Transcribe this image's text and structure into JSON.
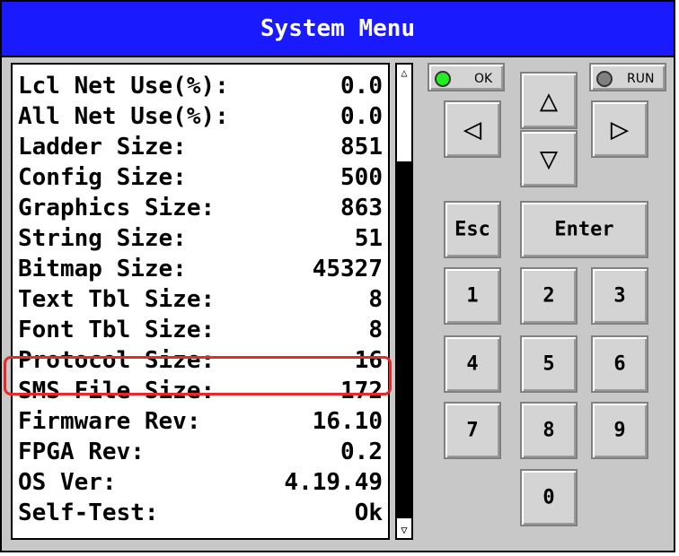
{
  "title": "System Menu",
  "rows": [
    {
      "label": "Lcl Net Use(%):",
      "value": "0.0"
    },
    {
      "label": "All Net Use(%):",
      "value": "0.0"
    },
    {
      "label": "Ladder Size:",
      "value": "851"
    },
    {
      "label": "Config Size:",
      "value": "500"
    },
    {
      "label": "Graphics Size:",
      "value": "863"
    },
    {
      "label": "String Size:",
      "value": "51"
    },
    {
      "label": "Bitmap Size:",
      "value": "45327"
    },
    {
      "label": "Text Tbl Size:",
      "value": "8"
    },
    {
      "label": "Font Tbl Size:",
      "value": "8"
    },
    {
      "label": "Protocol Size:",
      "value": "16"
    },
    {
      "label": "SMS File Size:",
      "value": "172"
    },
    {
      "label": "Firmware Rev:",
      "value": "16.10"
    },
    {
      "label": "FPGA Rev:",
      "value": "0.2"
    },
    {
      "label": "OS Ver:",
      "value": "4.19.49"
    },
    {
      "label": "Self-Test:",
      "value": "Ok"
    }
  ],
  "scrollbar": {
    "up_glyph": "△",
    "down_glyph": "▽"
  },
  "indicators": {
    "ok": {
      "label": "OK",
      "color": "#22ee22"
    },
    "run": {
      "label": "RUN",
      "color": "#808080"
    }
  },
  "keys": {
    "up": "△",
    "down": "▽",
    "left": "◁",
    "right": "▷",
    "esc": "Esc",
    "enter": "Enter",
    "k1": "1",
    "k2": "2",
    "k3": "3",
    "k4": "4",
    "k5": "5",
    "k6": "6",
    "k7": "7",
    "k8": "8",
    "k9": "9",
    "k0": "0"
  },
  "colors": {
    "title_bar": "#1a1aff",
    "highlight": "#e8282a"
  }
}
